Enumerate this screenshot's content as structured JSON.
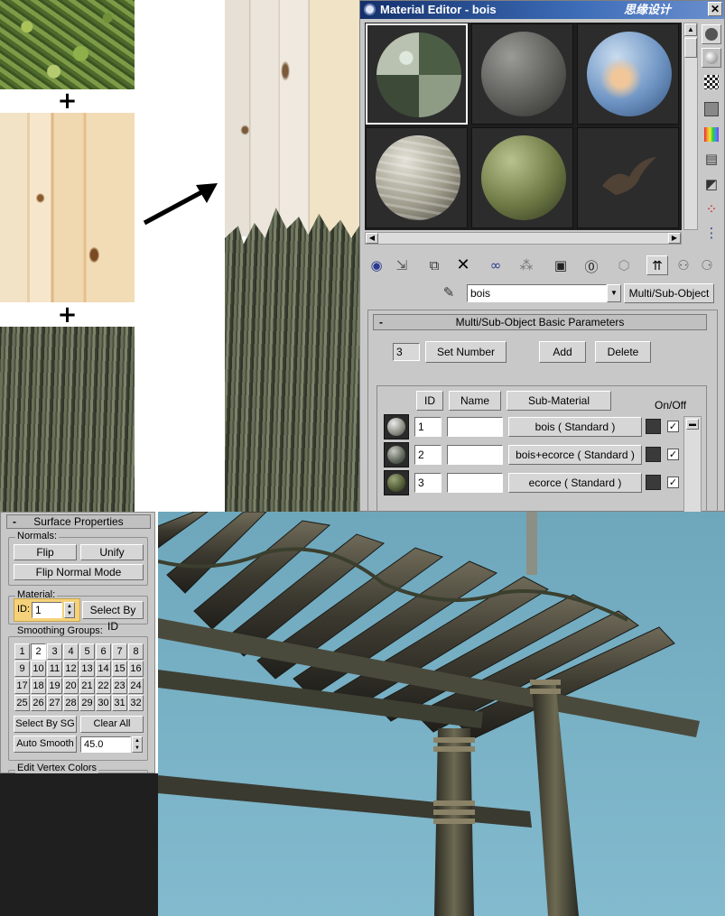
{
  "textures": {
    "plus_1": "+",
    "plus_2": "+"
  },
  "watermark": "思缘设计",
  "material_editor": {
    "title": "Material Editor - bois",
    "material_name": "bois",
    "type_button": "Multi/Sub-Object",
    "rollout_title": "Multi/Sub-Object Basic Parameters",
    "rollout_collapse": "-",
    "set_number_value": "3",
    "set_number_label": "Set Number",
    "add_label": "Add",
    "delete_label": "Delete",
    "columns": {
      "id": "ID",
      "name": "Name",
      "sub_material": "Sub-Material",
      "on_off": "On/Off"
    },
    "rows": [
      {
        "id": "1",
        "name": "",
        "sub_material": "bois  ( Standard )",
        "on": "✓"
      },
      {
        "id": "2",
        "name": "",
        "sub_material": "bois+ecorce  ( Standard )",
        "on": "✓"
      },
      {
        "id": "3",
        "name": "",
        "sub_material": "ecorce  ( Standard )",
        "on": "✓"
      }
    ]
  },
  "surface_properties": {
    "title": "Surface Properties",
    "collapse": "-",
    "normals_label": "Normals:",
    "flip": "Flip",
    "unify": "Unify",
    "flip_normal_mode": "Flip Normal Mode",
    "material_label": "Material:",
    "id_label": "ID:",
    "id_value": "1",
    "select_by_id": "Select By ID",
    "smoothing_label": "Smoothing Groups:",
    "groups": [
      "1",
      "2",
      "3",
      "4",
      "5",
      "6",
      "7",
      "8",
      "9",
      "10",
      "11",
      "12",
      "13",
      "14",
      "15",
      "16",
      "17",
      "18",
      "19",
      "20",
      "21",
      "22",
      "23",
      "24",
      "25",
      "26",
      "27",
      "28",
      "29",
      "30",
      "31",
      "32"
    ],
    "active_group": "2",
    "select_by_sg": "Select By SG",
    "clear_all": "Clear All",
    "auto_smooth": "Auto Smooth",
    "auto_smooth_value": "45.0",
    "edit_vertex_colors": "Edit Vertex Colors"
  },
  "colors": {
    "titlebar": "#14306b",
    "sky": "#7fb3c6",
    "panel": "#c8c8c8",
    "highlight": "#f5d27a"
  }
}
